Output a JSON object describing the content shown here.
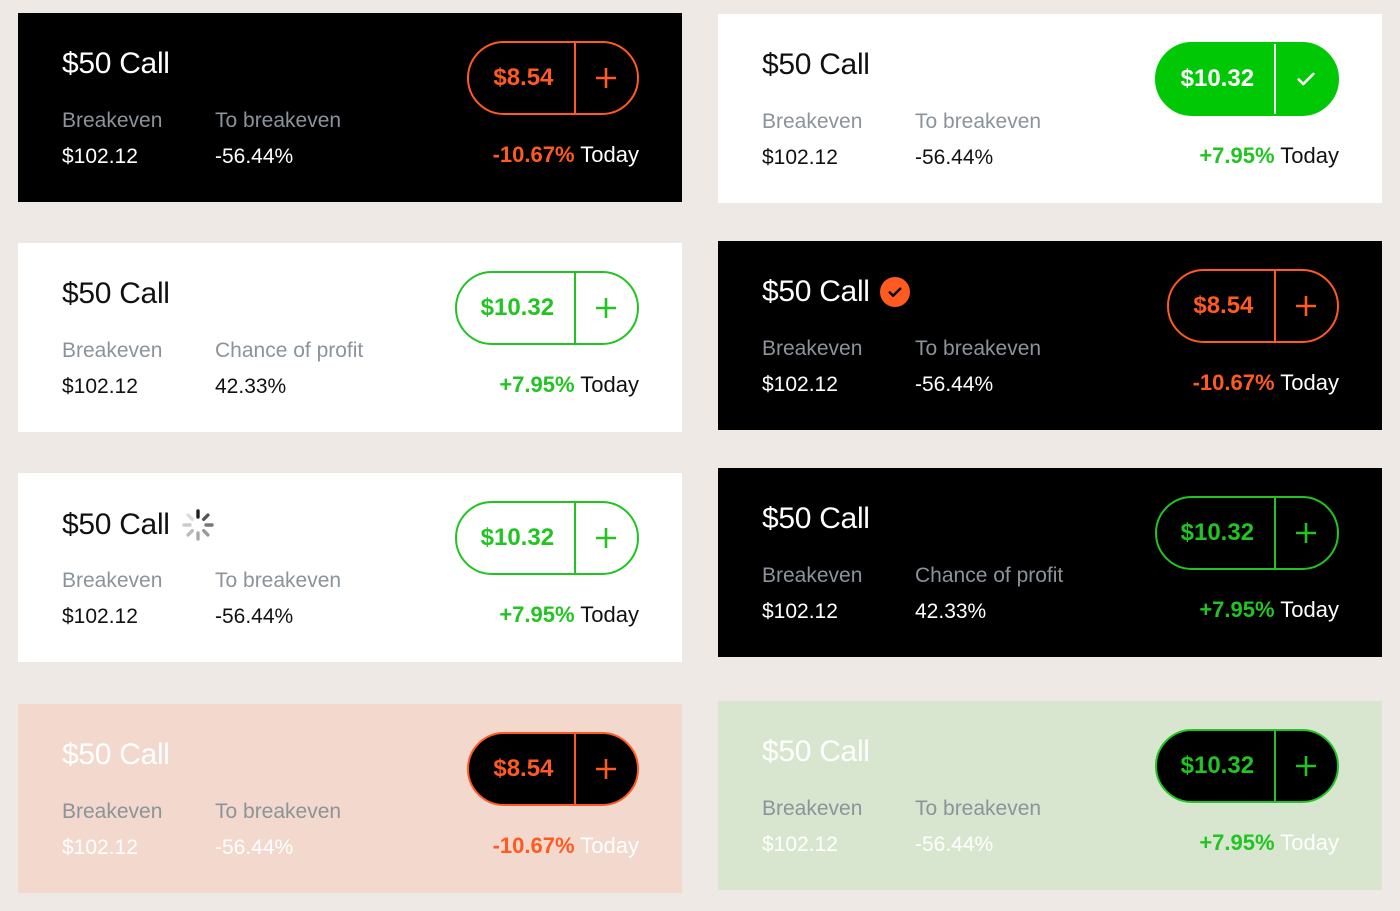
{
  "cards": [
    {
      "title": "$50 Call",
      "stat1_label": "Breakeven",
      "stat1_value": "$102.12",
      "stat2_label": "To breakeven",
      "stat2_value": "-56.44%",
      "price": "$8.54",
      "action": "+",
      "change": "-10.67%",
      "today": "Today"
    },
    {
      "title": "$50 Call",
      "stat1_label": "Breakeven",
      "stat1_value": "$102.12",
      "stat2_label": "To breakeven",
      "stat2_value": "-56.44%",
      "price": "$10.32",
      "action": "✓",
      "change": "+7.95%",
      "today": "Today"
    },
    {
      "title": "$50 Call",
      "stat1_label": "Breakeven",
      "stat1_value": "$102.12",
      "stat2_label": "Chance of profit",
      "stat2_value": "42.33%",
      "price": "$10.32",
      "action": "+",
      "change": "+7.95%",
      "today": "Today"
    },
    {
      "title": "$50 Call",
      "stat1_label": "Breakeven",
      "stat1_value": "$102.12",
      "stat2_label": "To breakeven",
      "stat2_value": "-56.44%",
      "price": "$8.54",
      "action": "+",
      "change": "-10.67%",
      "today": "Today"
    },
    {
      "title": "$50 Call",
      "stat1_label": "Breakeven",
      "stat1_value": "$102.12",
      "stat2_label": "To breakeven",
      "stat2_value": "-56.44%",
      "price": "$10.32",
      "action": "+",
      "change": "+7.95%",
      "today": "Today"
    },
    {
      "title": "$50 Call",
      "stat1_label": "Breakeven",
      "stat1_value": "$102.12",
      "stat2_label": "Chance of profit",
      "stat2_value": "42.33%",
      "price": "$10.32",
      "action": "+",
      "change": "+7.95%",
      "today": "Today"
    },
    {
      "title": "$50 Call",
      "stat1_label": "Breakeven",
      "stat1_value": "$102.12",
      "stat2_label": "To breakeven",
      "stat2_value": "-56.44%",
      "price": "$8.54",
      "action": "+",
      "change": "-10.67%",
      "today": "Today"
    },
    {
      "title": "$50 Call",
      "stat1_label": "Breakeven",
      "stat1_value": "$102.12",
      "stat2_label": "To breakeven",
      "stat2_value": "-56.44%",
      "price": "$10.32",
      "action": "+",
      "change": "+7.95%",
      "today": "Today"
    }
  ],
  "icons": {
    "card3": "check-circle-icon",
    "card4": "loading-spinner-icon"
  },
  "colors": {
    "negative": "#ff5a1f",
    "positive": "#21c421",
    "filled_positive": "#00c805",
    "background": "#efe9e5",
    "salmon_card": "#f2d8cd",
    "mint_card": "#d8e6d0"
  }
}
